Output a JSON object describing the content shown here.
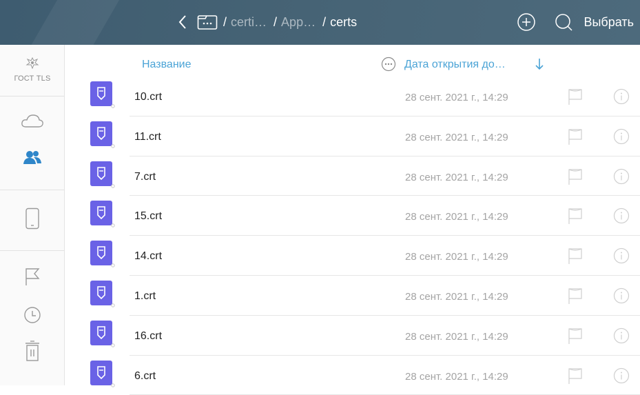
{
  "colors": {
    "topbar": "#456274",
    "accent": "#4aa3d6",
    "cert_icon": "#6a62e6",
    "text": "#222222",
    "muted": "#a4a4a4"
  },
  "topbar": {
    "back_icon": "chevron-left-icon",
    "folder_icon": "folder-icon",
    "breadcrumbs": [
      "certi…",
      "App…",
      "certs"
    ],
    "separator": "/",
    "add_icon": "plus-circle-icon",
    "search_icon": "search-icon",
    "select_label": "Выбрать"
  },
  "sidebar": {
    "gost_label": "ГОСТ TLS",
    "items": [
      "gost-logo-icon",
      "cloud-icon",
      "shared-users-icon",
      "tablet-icon",
      "flag-icon",
      "clock-icon",
      "trash-icon"
    ]
  },
  "list": {
    "col_name": "Название",
    "col_date": "Дата открытия до…",
    "sort_icon": "arrow-down-icon",
    "files": [
      {
        "name": "10.crt",
        "date": "28 сент. 2021 г., 14:29"
      },
      {
        "name": "11.crt",
        "date": "28 сент. 2021 г., 14:29"
      },
      {
        "name": "7.crt",
        "date": "28 сент. 2021 г., 14:29"
      },
      {
        "name": "15.crt",
        "date": "28 сент. 2021 г., 14:29"
      },
      {
        "name": "14.crt",
        "date": "28 сент. 2021 г., 14:29"
      },
      {
        "name": "1.crt",
        "date": "28 сент. 2021 г., 14:29"
      },
      {
        "name": "16.crt",
        "date": "28 сент. 2021 г., 14:29"
      },
      {
        "name": "6.crt",
        "date": "28 сент. 2021 г., 14:29"
      }
    ]
  }
}
